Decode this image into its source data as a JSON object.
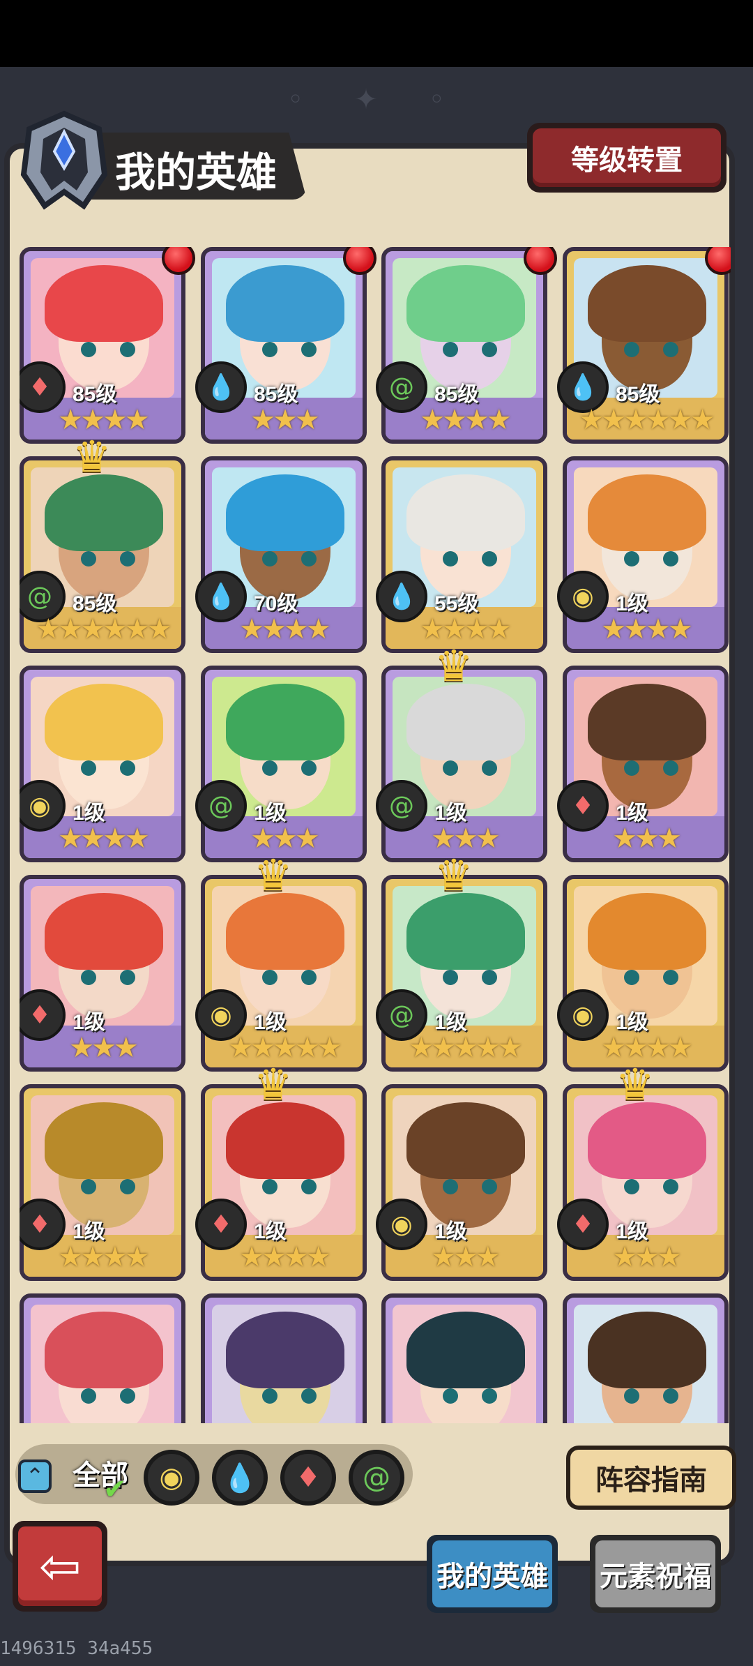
{
  "header": {
    "title": "我的英雄",
    "level_transfer_button": "等级转置"
  },
  "heroes": [
    {
      "level": "85级",
      "stars": "★★★★",
      "element": "fire",
      "frame": "purple",
      "badge": true,
      "crown": false,
      "hair": "#e8474a",
      "skin": "#fbdcd0",
      "bg": "#f4b3c2"
    },
    {
      "level": "85级",
      "stars": "★★★",
      "element": "water",
      "frame": "purple",
      "badge": true,
      "crown": false,
      "hair": "#3b9bd0",
      "skin": "#f9e0d4",
      "bg": "#bfe7f2"
    },
    {
      "level": "85级",
      "stars": "★★★★",
      "element": "wind",
      "frame": "purple",
      "badge": true,
      "crown": false,
      "hair": "#6fce8b",
      "skin": "#e6d1e8",
      "bg": "#c7e9c5"
    },
    {
      "level": "85级",
      "stars": "★★★★★★",
      "element": "water",
      "frame": "gold",
      "badge": true,
      "crown": false,
      "hair": "#7a4b2b",
      "skin": "#8a5b34",
      "bg": "#c9e3f1"
    },
    {
      "level": "85级",
      "stars": "★★★★★★",
      "element": "wind",
      "frame": "gold",
      "badge": false,
      "crown": true,
      "hair": "#3c8a58",
      "skin": "#d8a47e",
      "bg": "#eed4b8"
    },
    {
      "level": "70级",
      "stars": "★★★★",
      "element": "water",
      "frame": "purple",
      "badge": false,
      "crown": false,
      "hair": "#2f9dd8",
      "skin": "#9b6a45",
      "bg": "#bfe7f2"
    },
    {
      "level": "55级",
      "stars": "★★★★",
      "element": "water",
      "frame": "gold",
      "badge": false,
      "crown": false,
      "hair": "#e9e7e2",
      "skin": "#f9e2d3",
      "bg": "#c8e6ef"
    },
    {
      "level": "1级",
      "stars": "★★★★",
      "element": "earth",
      "frame": "purple",
      "badge": false,
      "crown": false,
      "hair": "#e58a3a",
      "skin": "#f2e6da",
      "bg": "#f7d9bd"
    },
    {
      "level": "1级",
      "stars": "★★★★",
      "element": "earth",
      "frame": "purple",
      "badge": false,
      "crown": false,
      "hair": "#f2c24e",
      "skin": "#fbe4d2",
      "bg": "#f5d6c4"
    },
    {
      "level": "1级",
      "stars": "★★★",
      "element": "wind",
      "frame": "purple",
      "badge": false,
      "crown": false,
      "hair": "#3fa85c",
      "skin": "#f6dcc8",
      "bg": "#cde98f"
    },
    {
      "level": "1级",
      "stars": "★★★",
      "element": "wind",
      "frame": "purple",
      "badge": false,
      "crown": true,
      "hair": "#d9d9d9",
      "skin": "#f1d4bd",
      "bg": "#c6e5c0"
    },
    {
      "level": "1级",
      "stars": "★★★",
      "element": "fire",
      "frame": "purple",
      "badge": false,
      "crown": false,
      "hair": "#5b3a26",
      "skin": "#a8693f",
      "bg": "#f2b6b0"
    },
    {
      "level": "1级",
      "stars": "★★★",
      "element": "fire",
      "frame": "purple",
      "badge": false,
      "crown": false,
      "hair": "#e24a3c",
      "skin": "#f3d9c8",
      "bg": "#f3b7bb"
    },
    {
      "level": "1级",
      "stars": "★★★★★",
      "element": "earth",
      "frame": "gold",
      "badge": false,
      "crown": true,
      "hair": "#e8773a",
      "skin": "#f7dac6",
      "bg": "#f5d4b1"
    },
    {
      "level": "1级",
      "stars": "★★★★★",
      "element": "wind",
      "frame": "gold",
      "badge": false,
      "crown": true,
      "hair": "#3b9e6b",
      "skin": "#f4e3d8",
      "bg": "#c7e8c8"
    },
    {
      "level": "1级",
      "stars": "★★★★",
      "element": "earth",
      "frame": "gold",
      "badge": false,
      "crown": false,
      "hair": "#e3892e",
      "skin": "#f0c394",
      "bg": "#f6d6a8"
    },
    {
      "level": "1级",
      "stars": "★★★★",
      "element": "fire",
      "frame": "gold",
      "badge": false,
      "crown": false,
      "hair": "#b88a2a",
      "skin": "#d8b271",
      "bg": "#f1c3b7"
    },
    {
      "level": "1级",
      "stars": "★★★★",
      "element": "fire",
      "frame": "gold",
      "badge": false,
      "crown": true,
      "hair": "#c9352f",
      "skin": "#f8dfd0",
      "bg": "#f3bfbe"
    },
    {
      "level": "1级",
      "stars": "★★★",
      "element": "earth",
      "frame": "gold",
      "badge": false,
      "crown": false,
      "hair": "#6a4227",
      "skin": "#a06a42",
      "bg": "#efd4bd"
    },
    {
      "level": "1级",
      "stars": "★★★",
      "element": "fire",
      "frame": "gold",
      "badge": false,
      "crown": true,
      "hair": "#e35a86",
      "skin": "#f6d8cf",
      "bg": "#f1c1c6"
    },
    {
      "level": "",
      "stars": "",
      "element": "fire",
      "frame": "purple",
      "badge": false,
      "crown": false,
      "hair": "#d9505a",
      "skin": "#f9dcd2",
      "bg": "#f4c3cd"
    },
    {
      "level": "",
      "stars": "",
      "element": "wind",
      "frame": "purple",
      "badge": false,
      "crown": false,
      "hair": "#4b3a6a",
      "skin": "#e9d9a0",
      "bg": "#d8cfe6"
    },
    {
      "level": "",
      "stars": "",
      "element": "fire",
      "frame": "purple",
      "badge": false,
      "crown": false,
      "hair": "#1f3a44",
      "skin": "#f6dcc9",
      "bg": "#f2c6cf"
    },
    {
      "level": "",
      "stars": "",
      "element": "earth",
      "frame": "purple",
      "badge": false,
      "crown": false,
      "hair": "#4a3222",
      "skin": "#e6b48f",
      "bg": "#d7e6ef"
    }
  ],
  "filter": {
    "all_label": "全部",
    "elements": [
      "earth",
      "water",
      "fire",
      "wind"
    ]
  },
  "guide_button": "阵容指南",
  "tabs": {
    "my_heroes": "我的英雄",
    "element_blessing": "元素祝福"
  },
  "watermark": "1496315 34a455",
  "colors": {
    "panel": "#e8dcc0",
    "purple_frame": "#b99ce0",
    "gold_frame": "#e9c768",
    "fire": "#f26b6b",
    "water": "#4aa7e6",
    "wind": "#6cc85a",
    "earth": "#f1d45c",
    "active_tab": "#3d8ec4",
    "inactive_tab": "#8a8a8a"
  }
}
